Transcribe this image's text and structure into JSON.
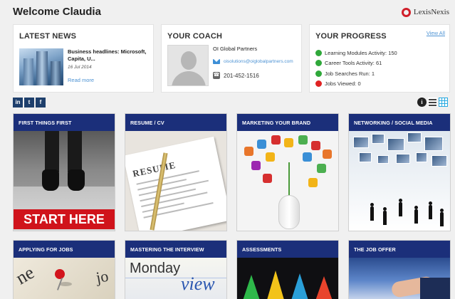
{
  "header": {
    "welcome": "Welcome Claudia",
    "logo_text": "LexisNexis",
    "logo_color": "#d01f2a"
  },
  "news": {
    "title": "LATEST NEWS",
    "headline": "Business headlines: Microsoft, Capita, U...",
    "date": "16 Jul 2014",
    "read_more": "Read more"
  },
  "coach": {
    "title": "YOUR COACH",
    "org": "OI Global Partners",
    "email": "oisolutions@oiglobalpartners.com",
    "phone": "201-452-1516"
  },
  "progress": {
    "title": "YOUR PROGRESS",
    "view_all": "View All",
    "items": [
      {
        "label": "Learning Modules Activity: 150",
        "color": "#2fa83a"
      },
      {
        "label": "Career Tools Activity: 61",
        "color": "#2fa83a"
      },
      {
        "label": "Job Searches Run: 1",
        "color": "#2fa83a"
      },
      {
        "label": "Jobs Viewed: 0",
        "color": "#e02323"
      }
    ]
  },
  "social": {
    "linkedin": "in",
    "twitter": "t",
    "facebook": "f",
    "linkedin_icon": "linkedin-icon",
    "twitter_icon": "twitter-icon",
    "facebook_icon": "facebook-icon"
  },
  "view_toggle": {
    "info_glyph": "i",
    "active": "grid"
  },
  "tiles": [
    {
      "title": "FIRST THINGS FIRST",
      "image_text": "START HERE"
    },
    {
      "title": "RESUME / CV",
      "image_text": "RESUME"
    },
    {
      "title": "MARKETING YOUR BRAND"
    },
    {
      "title": "NETWORKING / SOCIAL MEDIA"
    },
    {
      "title": "APPLYING FOR JOBS",
      "image_text": "ne",
      "image_text_2": "jo"
    },
    {
      "title": "MASTERING THE INTERVIEW",
      "image_text": "Monday",
      "image_text_2": "view"
    },
    {
      "title": "ASSESSMENTS"
    },
    {
      "title": "THE JOB OFFER"
    }
  ],
  "theme": {
    "tile_header": "#1b2f7a",
    "link": "#4f94d4",
    "grid_active": "#27a9e0"
  }
}
